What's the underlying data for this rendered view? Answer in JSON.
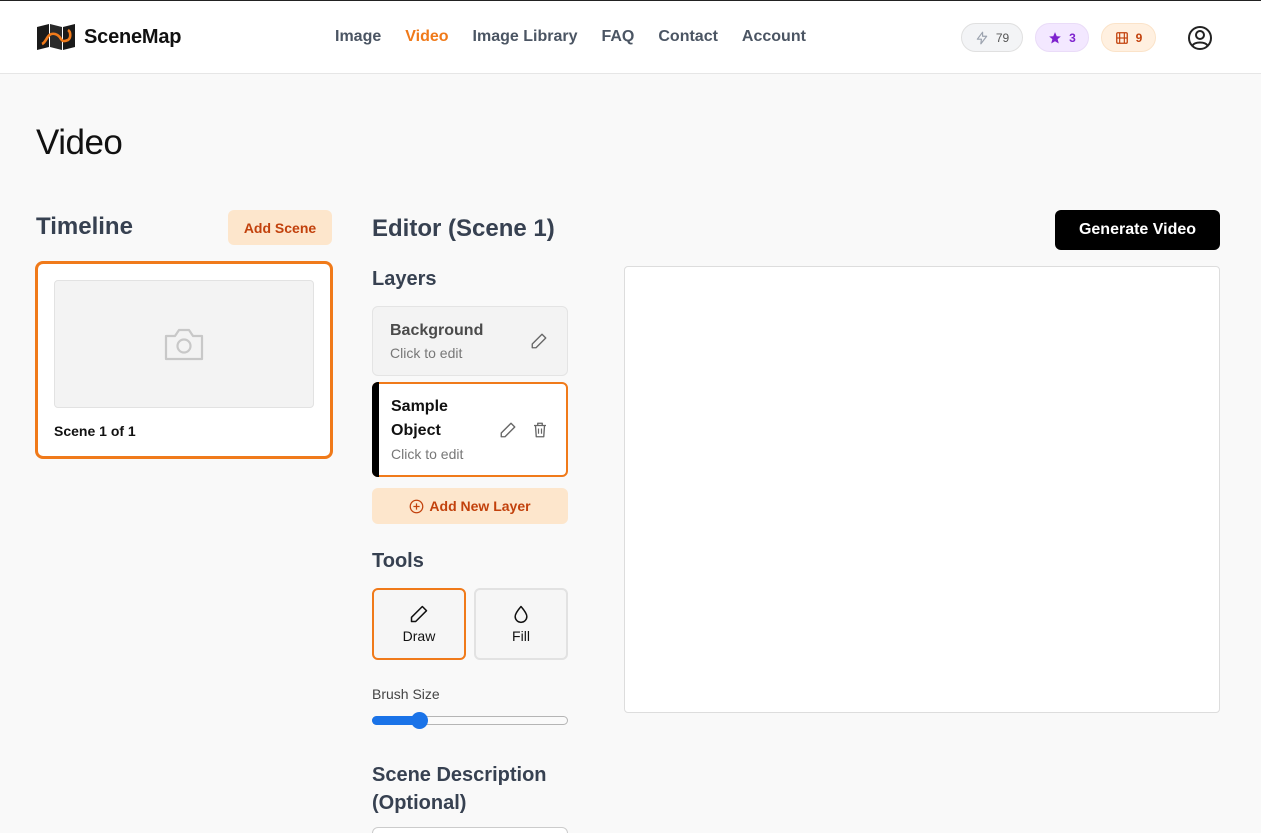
{
  "brand": {
    "name": "SceneMap"
  },
  "nav": [
    {
      "label": "Image",
      "active": false
    },
    {
      "label": "Video",
      "active": true
    },
    {
      "label": "Image Library",
      "active": false
    },
    {
      "label": "FAQ",
      "active": false
    },
    {
      "label": "Contact",
      "active": false
    },
    {
      "label": "Account",
      "active": false
    }
  ],
  "badges": {
    "energy": {
      "icon": "lightning-icon",
      "count": "79"
    },
    "stars": {
      "icon": "star-icon",
      "count": "3"
    },
    "film": {
      "icon": "film-icon",
      "count": "9"
    }
  },
  "page": {
    "title": "Video"
  },
  "timeline": {
    "title": "Timeline",
    "add_scene_label": "Add Scene",
    "scene_label": "Scene 1 of 1"
  },
  "editor": {
    "title": "Editor (Scene 1)",
    "generate_label": "Generate Video",
    "layers_heading": "Layers",
    "layers": [
      {
        "name": "Background",
        "sub": "Click to edit"
      },
      {
        "name": "Sample Object",
        "sub": "Click to edit"
      }
    ],
    "add_layer_label": "Add New Layer",
    "tools_heading": "Tools",
    "tools": [
      {
        "label": "Draw",
        "icon": "pencil-icon",
        "selected": true
      },
      {
        "label": "Fill",
        "icon": "droplet-icon",
        "selected": false
      }
    ],
    "brush_size_label": "Brush Size",
    "brush_size_fraction": 0.22,
    "scene_description_heading": "Scene Description (Optional)"
  },
  "colors": {
    "accent": "#f07a1a",
    "accent_soft": "#fde6cc",
    "accent_text": "#c2410c",
    "slider": "#1a73e8"
  }
}
